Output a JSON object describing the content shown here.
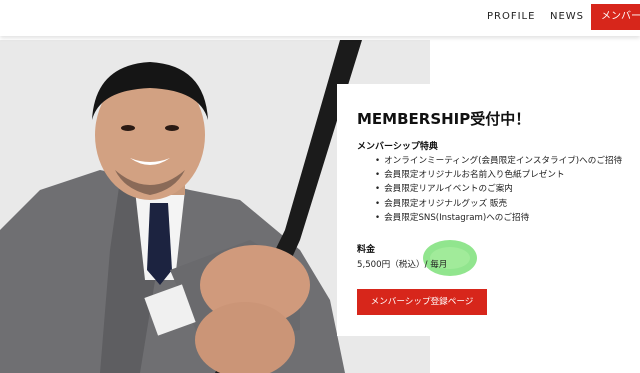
{
  "nav": {
    "profile": "PROFILE",
    "news": "NEWS",
    "member": "メンバーシップ"
  },
  "card": {
    "title": "MEMBERSHIP受付中！",
    "benefits_heading": "メンバーシップ特典",
    "benefits": [
      "オンラインミーティング(会員限定インスタライブ)へのご招待",
      "会員限定オリジナルお名前入り色紙プレゼント",
      "会員限定リアルイベントのご案内",
      "会員限定オリジナルグッズ 販売",
      "会員限定SNS(Instagram)へのご招待"
    ],
    "price_heading": "料金",
    "price_value": "5,500円（税込）/ 毎月",
    "register_button": "メンバーシップ登録ページ"
  },
  "colors": {
    "accent_red": "#d7261b",
    "highlight_green": "#7ee07a"
  }
}
